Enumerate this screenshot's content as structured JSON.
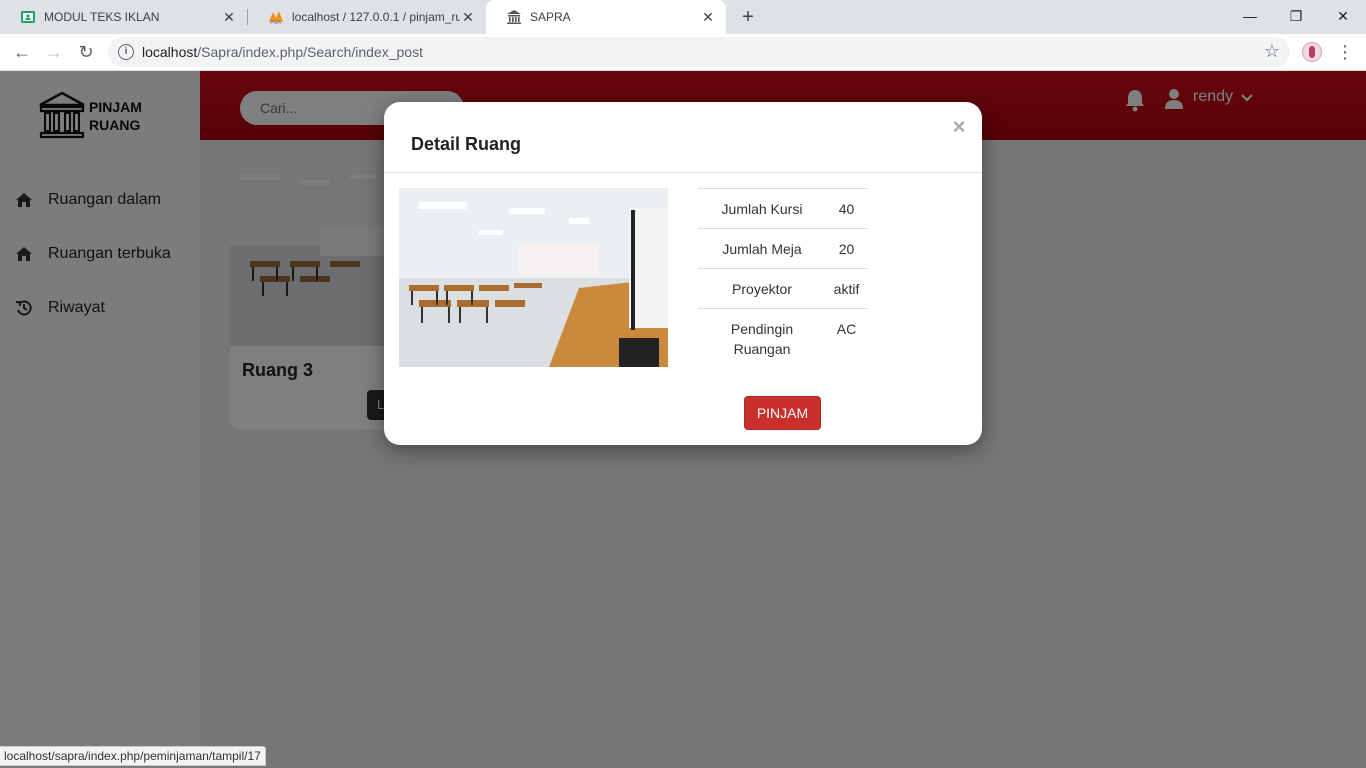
{
  "browser": {
    "tabs": [
      {
        "title": "MODUL TEKS IKLAN",
        "icon": "classroom-icon"
      },
      {
        "title": "localhost / 127.0.0.1 / pinjam_ruang",
        "icon": "phpmyadmin-icon"
      },
      {
        "title": "SAPRA",
        "icon": "building-icon"
      }
    ],
    "url_host": "localhost",
    "url_path": "/Sapra/index.php/Search/index_post",
    "status_url": "localhost/sapra/index.php/peminjaman/tampil/17"
  },
  "sidebar": {
    "logo_line1": "PINJAM",
    "logo_line2": "RUANG",
    "items": [
      {
        "label": "Ruangan dalam",
        "icon": "home-icon"
      },
      {
        "label": "Ruangan terbuka",
        "icon": "home-icon"
      },
      {
        "label": "Riwayat",
        "icon": "history-icon"
      }
    ]
  },
  "header": {
    "search_placeholder": "Cari...",
    "username": "rendy",
    "accent": "#c30a14"
  },
  "card": {
    "title": "Ruang 3",
    "button_label": "Lihat"
  },
  "modal": {
    "title": "Detail Ruang",
    "close": "×",
    "details": [
      {
        "label": "Jumlah Kursi",
        "value": "40"
      },
      {
        "label": "Jumlah Meja",
        "value": "20"
      },
      {
        "label": "Proyektor",
        "value": "aktif"
      },
      {
        "label": "Pendingin Ruangan",
        "value": "AC"
      }
    ],
    "action_label": "PINJAM"
  }
}
